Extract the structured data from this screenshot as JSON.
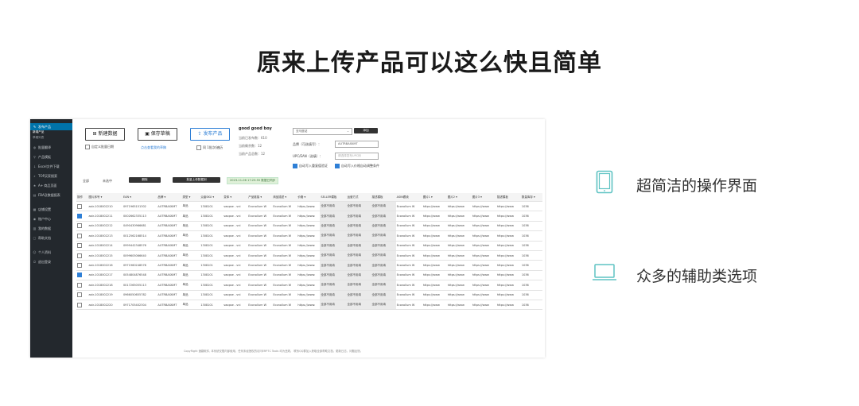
{
  "page_title": "原来上传产品可以这么快且简单",
  "features": [
    {
      "label": "超简洁的操作界面",
      "icon": "tablet-icon"
    },
    {
      "label": "众多的辅助类选项",
      "icon": "laptop-icon"
    }
  ],
  "colors": {
    "accent": "#2e7fd6",
    "sidebar": "#23282d",
    "teal_icon": "#5fc3c3"
  },
  "screenshot": {
    "sidebar": {
      "items": [
        {
          "label": "发布产品",
          "icon": "edit-icon",
          "active": true
        },
        {
          "label": "新增产品",
          "sub": true,
          "current": true
        },
        {
          "label": "草稿列表",
          "sub": true
        },
        {
          "label": "批量翻译",
          "icon": "globe-icon"
        },
        {
          "label": "产品模板",
          "icon": "link-icon"
        },
        {
          "label": "Excel文件下载",
          "icon": "download-icon"
        },
        {
          "label": "TOP买家搜索",
          "icon": "search-icon"
        },
        {
          "label": "A+ 商品页面",
          "icon": "star-icon"
        },
        {
          "label": "FBA及数据报表",
          "icon": "chart-icon"
        },
        {
          "label": "店铺设置",
          "icon": "box-icon"
        },
        {
          "label": "账户中心",
          "icon": "user-icon"
        },
        {
          "label": "我的数据",
          "icon": "data-icon"
        },
        {
          "label": "帮助文档",
          "icon": "book-icon"
        },
        {
          "label": "个人资料",
          "icon": "profile-icon"
        },
        {
          "label": "退出登录",
          "icon": "power-icon"
        }
      ]
    },
    "toolbar": {
      "new_label": "新建数据",
      "new_check": "自定义批量日期",
      "save_label": "保存草稿",
      "save_link": "点击查看我的草稿",
      "publish_label": "发布产品",
      "publish_check": "同 1批次/遍历",
      "account_name": "good good boy",
      "stat1": "当前已发布数：610",
      "stat2": "当前剩余数：12",
      "stat3": "当前产品总数：12",
      "select_value": "亚马逊站",
      "select_btn": "添加",
      "brand_label": "品牌（可选填写）：",
      "brand_value": "AUTRBASKMT",
      "code_label": "UPC/EAN（选填）：",
      "code_placeholder": "请选择发布UPC码",
      "opt1": "自动写入重复值验证",
      "opt2": "自动写入价格自动调整条件"
    },
    "list_bar": {
      "all": "全部",
      "unselected": "未选中",
      "delete_btn": "删除",
      "batch_btn": "批量上传数据到",
      "status": "2023-11-06 17:25:55 数据已同步"
    },
    "table": {
      "headers": [
        "操作",
        "图片序号 ▾",
        "EAN ▾",
        "品牌 ▾",
        "类型 ▾",
        "父级SKU ▾",
        "变体 ▾",
        "产品链接 ▾",
        "商品描述 ▾",
        "价格 ▾",
        "SELLER模板",
        "运营方式",
        "描述模板",
        "ASIN跟卖",
        "图片1 ▾",
        "图片2 ▾",
        "图片3 ▾",
        "描述模板",
        "数量库存 ▾"
      ],
      "rows": [
        {
          "id": "astr-1018002210",
          "ean": "0971965151302",
          "check": false
        },
        {
          "id": "astr-1018002211",
          "ean": "0002662335113",
          "check": true
        },
        {
          "id": "astr-1018002212",
          "ean": "0490430966681",
          "check": false
        },
        {
          "id": "astr-1018002213",
          "ean": "0012562168514",
          "check": false
        },
        {
          "id": "astr-1018002214",
          "ean": "0999442348576",
          "check": false
        },
        {
          "id": "astr-1018002215",
          "ean": "0099605066640",
          "check": false
        },
        {
          "id": "astr-1018002216",
          "ean": "0971960248578",
          "check": false
        },
        {
          "id": "astr-1018002217",
          "ean": "0054804876548",
          "check": true
        },
        {
          "id": "astr-1018002218",
          "ean": "0017265055113",
          "check": false
        },
        {
          "id": "astr-1018002219",
          "ean": "0966050655782",
          "check": false
        },
        {
          "id": "astr-1018002220",
          "ean": "0971705402304",
          "check": false
        }
      ],
      "common": {
        "brand": "AUTRBASKMT",
        "type": "单品",
        "parent": "1308101",
        "variant": "vaopse - vni",
        "link": "Econollum W",
        "desc": "Econollum W",
        "price": "https://www.",
        "seller": "全部不用填",
        "ship": "全部不用填",
        "tpl": "全部不用填",
        "asin": "Econollum W",
        "img1": "https://www",
        "img2": "https://www",
        "img3": "https://www",
        "tpl2": "https://www",
        "stock": "1036"
      }
    },
    "footer": "CopyRight 速翻软件, 本系统仅限内部使用，任何未经授权的访问ERP7C Tools 均为违规。 联系QQ群加入获取全部帮助文档，更新日志，问题反馈。"
  }
}
